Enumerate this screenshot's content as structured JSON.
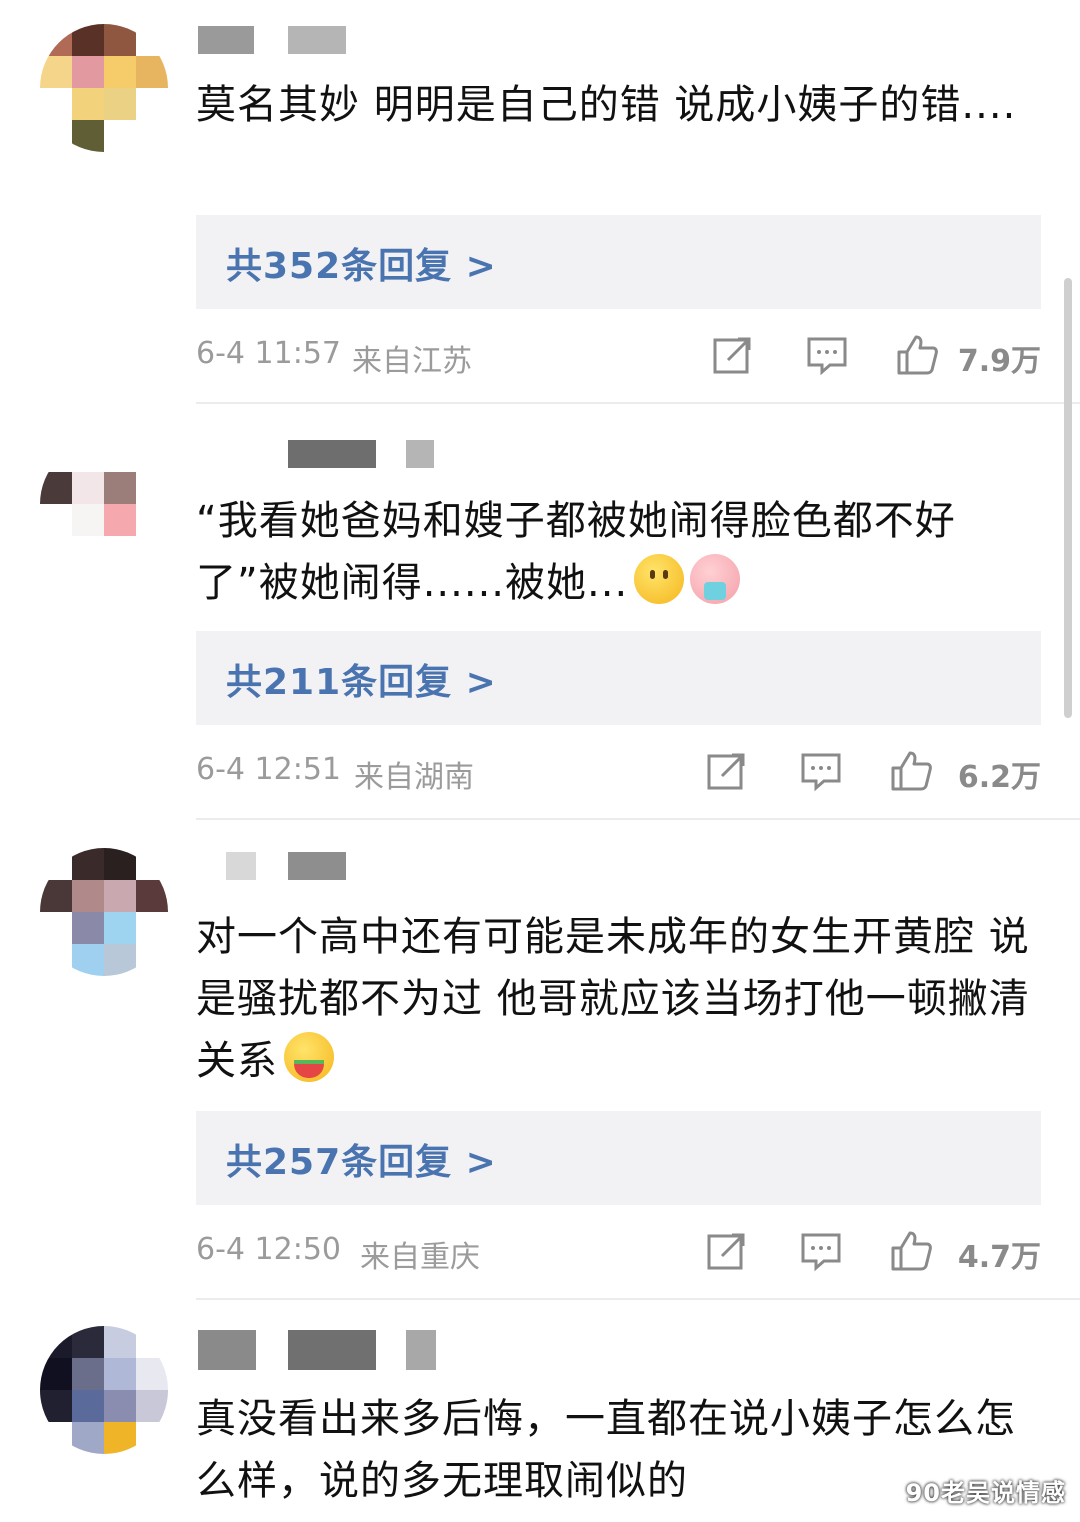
{
  "comments": [
    {
      "text": "莫名其妙 明明是自己的错 说成小姨子的错....",
      "reply_count": "共352条回复 >",
      "time": "6-4 11:57",
      "location": "来自江苏",
      "likes": "7.9万"
    },
    {
      "text": "“我看她爸妈和嫂子都被她闹得脸色都不好了”被她闹得......被她...",
      "emojis": [
        "smile-emoji",
        "vomit-emoji"
      ],
      "reply_count": "共211条回复 >",
      "time": "6-4 12:51",
      "location": "来自湖南",
      "likes": "6.2万"
    },
    {
      "text": "对一个高中还有可能是未成年的女生开黄腔 说是骚扰都不为过 他哥就应该当场打他一顿撇清关系",
      "emojis": [
        "eating-emoji"
      ],
      "reply_count": "共257条回复 >",
      "time": "6-4 12:50",
      "location": "来自重庆",
      "likes": "4.7万"
    },
    {
      "text": "真没看出来多后悔，一直都在说小姨子怎么怎么样，说的多无理取闹似的"
    }
  ],
  "icons": [
    "share-icon",
    "comment-icon",
    "thumbs-up-icon"
  ],
  "colors": {
    "reply_link": "#4a74b0",
    "meta_text": "#9b9b9b",
    "reply_bg": "#f2f2f4"
  },
  "watermark": "90老吴说情感"
}
